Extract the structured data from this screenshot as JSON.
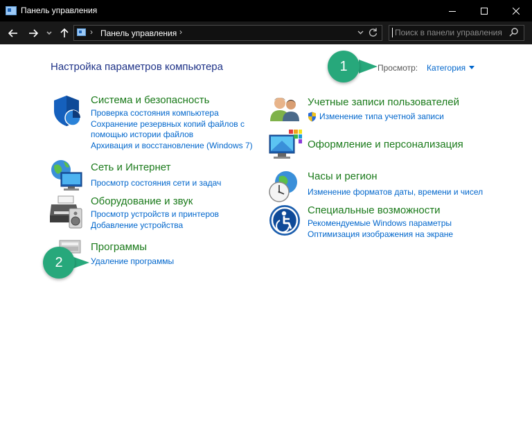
{
  "window": {
    "title": "Панель управления",
    "controls": [
      "minimize-icon",
      "maximize-icon",
      "close-icon"
    ]
  },
  "navbar": {
    "breadcrumb": "Панель управления",
    "search_placeholder": "Поиск в панели управления"
  },
  "main": {
    "heading": "Настройка параметров компьютера",
    "view_label": "Просмотр:",
    "view_value": "Категория"
  },
  "categories_left": [
    {
      "title": "Система и безопасность",
      "icon": "shield-icon",
      "links": [
        "Проверка состояния компьютера",
        "Сохранение резервных копий файлов с помощью истории файлов",
        "Архивация и восстановление (Windows 7)"
      ]
    },
    {
      "title": "Сеть и Интернет",
      "icon": "network-globe-icon",
      "links": [
        "Просмотр состояния сети и задач"
      ]
    },
    {
      "title": "Оборудование и звук",
      "icon": "printer-speaker-icon",
      "links": [
        "Просмотр устройств и принтеров",
        "Добавление устройства"
      ]
    },
    {
      "title": "Программы",
      "icon": "programs-icon",
      "links": [
        "Удаление программы"
      ]
    }
  ],
  "categories_right": [
    {
      "title": "Учетные записи пользователей",
      "icon": "users-icon",
      "links": [
        "Изменение типа учетной записи"
      ]
    },
    {
      "title": "Оформление и персонализация",
      "icon": "monitor-palette-icon",
      "links": []
    },
    {
      "title": "Часы и регион",
      "icon": "clock-globe-icon",
      "links": [
        "Изменение форматов даты, времени и чисел"
      ]
    },
    {
      "title": "Специальные возможности",
      "icon": "accessibility-icon",
      "links": [
        "Рекомендуемые Windows параметры",
        "Оптимизация изображения на экране"
      ]
    }
  ],
  "annotations": {
    "badge1": "1",
    "badge2": "2"
  },
  "colors": {
    "titlebar": "#000000",
    "navbar": "#191919",
    "heading": "#1e3287",
    "category_title": "#1a7a1a",
    "link": "#0066cc",
    "badge": "#27a87b"
  }
}
